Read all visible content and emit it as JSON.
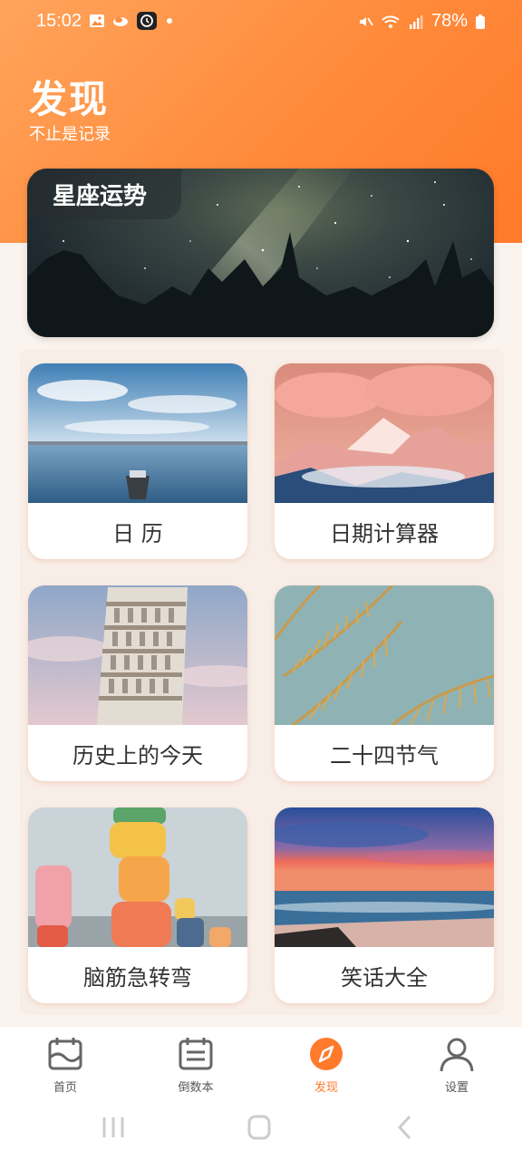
{
  "status_bar": {
    "time": "15:02",
    "battery": "78%",
    "icons_left": [
      "image-icon",
      "cloud-icon",
      "alarm-icon",
      "dot-icon"
    ],
    "icons_right": [
      "mute-icon",
      "wifi-icon",
      "signal-icon",
      "battery-icon"
    ]
  },
  "header": {
    "title": "发现",
    "subtitle": "不止是记录"
  },
  "banner": {
    "label": "星座运势"
  },
  "cards": [
    {
      "label": "日 历"
    },
    {
      "label": "日期计算器"
    },
    {
      "label": "历史上的今天"
    },
    {
      "label": "二十四节气"
    },
    {
      "label": "脑筋急转弯"
    },
    {
      "label": "笑话大全"
    }
  ],
  "nav": {
    "items": [
      {
        "label": "首页",
        "icon": "calendar-wave-icon"
      },
      {
        "label": "倒数本",
        "icon": "countdown-list-icon"
      },
      {
        "label": "发现",
        "icon": "compass-icon"
      },
      {
        "label": "设置",
        "icon": "user-icon"
      }
    ],
    "active_index": 2,
    "accent": "#ff7a2b"
  },
  "system_nav": {
    "buttons": [
      "recent-apps-icon",
      "home-icon",
      "back-icon"
    ]
  }
}
